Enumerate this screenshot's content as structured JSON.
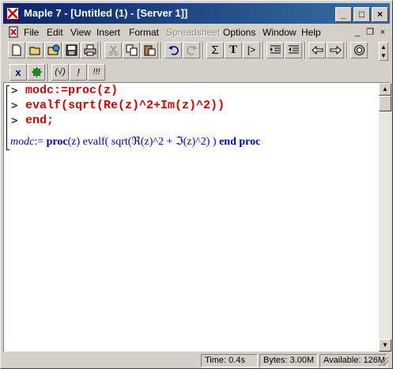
{
  "window": {
    "title": "Maple 7  - [Untitled (1) - [Server 1]]"
  },
  "menubar": {
    "items": [
      {
        "label": "File",
        "disabled": false
      },
      {
        "label": "Edit",
        "disabled": false
      },
      {
        "label": "View",
        "disabled": false
      },
      {
        "label": "Insert",
        "disabled": false
      },
      {
        "label": "Format",
        "disabled": false
      },
      {
        "label": "Spreadsheet",
        "disabled": true
      },
      {
        "label": "Options",
        "disabled": false
      },
      {
        "label": "Window",
        "disabled": false
      },
      {
        "label": "Help",
        "disabled": false
      }
    ],
    "mdi_buttons": [
      "_",
      "❐",
      "×"
    ]
  },
  "toolbar": {
    "sigma_label": "Σ",
    "text_label": "T",
    "prompt_label": "[>",
    "math_x_label": "x",
    "syntax_check_label": "(√)",
    "exec_label": "!",
    "exec_all_label": "!!!"
  },
  "worksheet": {
    "prompt_symbol": ">",
    "input_lines": [
      "modc:=proc(z)",
      "evalf(sqrt(Re(z)^2+Im(z)^2))",
      "end;"
    ],
    "output": {
      "lhs": "modc",
      "assign": ":=",
      "proc_kw": "proc",
      "param": "(z)",
      "body_pre": " evalf( sqrt(",
      "re_symbol": "ℜ",
      "re_arg": "(z)",
      "pow1": "^2 + ",
      "im_symbol": "ℑ",
      "im_arg": "(z)",
      "pow2": "^2) )",
      "end_kw": "end proc"
    }
  },
  "statusbar": {
    "time": "Time:   0.4s",
    "bytes": "Bytes: 3.00M",
    "available": "Available: 126M"
  },
  "colors": {
    "input": "#d40000",
    "output": "#0000c8",
    "titlebar_start": "#0a246a",
    "titlebar_end": "#3a6ea5"
  }
}
